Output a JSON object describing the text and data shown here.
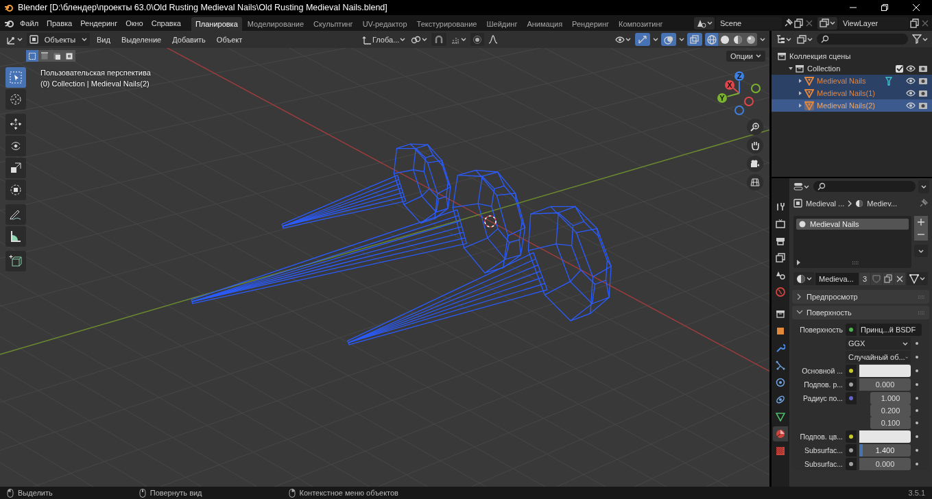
{
  "window": {
    "title": "Blender [D:\\блендер\\проекты 63.0\\Old Rusting Medieval Nails\\Old Rusting Medieval Nails.blend]"
  },
  "menu": [
    "Файл",
    "Правка",
    "Рендеринг",
    "Окно",
    "Справка"
  ],
  "workspaces": [
    {
      "label": "Планировка",
      "selected": true
    },
    {
      "label": "Моделирование",
      "selected": false
    },
    {
      "label": "Скульптинг",
      "selected": false
    },
    {
      "label": "UV-редактор",
      "selected": false
    },
    {
      "label": "Текстурирование",
      "selected": false
    },
    {
      "label": "Шейдинг",
      "selected": false
    },
    {
      "label": "Анимация",
      "selected": false
    },
    {
      "label": "Рендеринг",
      "selected": false
    },
    {
      "label": "Композитинг",
      "selected": false
    }
  ],
  "scene": {
    "name": "Scene"
  },
  "view_layer": {
    "name": "ViewLayer"
  },
  "viewport": {
    "mode": "Объекты",
    "menus": [
      "Вид",
      "Выделение",
      "Добавить",
      "Объект"
    ],
    "orientation": "Глоба...",
    "options": "Опции",
    "view_name": "Пользовательская перспектива",
    "context": "(0) Collection | Medieval Nails(2)",
    "axes": [
      "X",
      "Y",
      "Z"
    ],
    "gizmos_on": true,
    "overlays_on": true,
    "xray_on": true,
    "shading": [
      {
        "selected": true
      },
      {
        "selected": false
      },
      {
        "selected": false
      },
      {
        "selected": false
      }
    ],
    "select_modes": [
      {
        "selected": true
      },
      {
        "selected": false
      },
      {
        "selected": false
      },
      {
        "selected": false
      }
    ],
    "tools": [
      {
        "selected": true
      },
      {
        "selected": false
      },
      {
        "selected": false
      },
      {
        "selected": false
      },
      {
        "selected": false
      },
      {
        "selected": false
      },
      {
        "selected": false
      },
      {
        "selected": false
      },
      {
        "selected": false
      }
    ]
  },
  "outliner": {
    "tree": [
      {
        "label": "Коллекция сцены",
        "children": [
          {
            "label": "Collection",
            "expanded": true,
            "checked": true,
            "children": [
              {
                "label": "Medieval Nails",
                "selected": true,
                "active": false,
                "expanded": false,
                "modifier_icon": true
              },
              {
                "label": "Medieval Nails(1)",
                "selected": true,
                "active": false,
                "expanded": false,
                "modifier_icon": false
              },
              {
                "label": "Medieval Nails(2)",
                "selected": true,
                "active": true,
                "expanded": false,
                "modifier_icon": false
              }
            ]
          }
        ]
      }
    ]
  },
  "properties": {
    "tabs": [
      {
        "selected": false
      },
      {
        "selected": false
      },
      {
        "selected": false
      },
      {
        "selected": false
      },
      {
        "selected": false
      },
      {
        "selected": false
      },
      {
        "selected": false
      },
      {
        "selected": false
      },
      {
        "selected": false
      },
      {
        "selected": false
      },
      {
        "selected": false
      },
      {
        "selected": false
      },
      {
        "selected": false
      },
      {
        "selected": true
      },
      {
        "selected": false
      }
    ],
    "breadcrumb": [
      "Medieval ...",
      "Mediev..."
    ],
    "slots": [
      {
        "label": "Medieval Nails",
        "selected": true
      }
    ],
    "material": {
      "name": "Medieva...",
      "users": "3"
    },
    "panels": [
      {
        "label": "Предпросмотр",
        "expanded": false
      },
      {
        "label": "Поверхность",
        "expanded": true
      }
    ],
    "rows": [
      {
        "kind": "shader",
        "label": "Поверхность",
        "value": "Принц...й BSDF",
        "color": "#4db34d"
      },
      {
        "kind": "dropdown",
        "value": "GGX"
      },
      {
        "kind": "dropdown",
        "value": "Случайный об..."
      },
      {
        "kind": "color",
        "label": "Основной ...",
        "swatch": {
          "color": "#e6e6e6"
        },
        "color": "#c7c729"
      },
      {
        "kind": "value",
        "label": "Подпов. р...",
        "value": "0.000",
        "color": "#a1a1a1"
      },
      {
        "kind": "vector",
        "label": "Радиус по...",
        "values": [
          "1.000",
          "0.200",
          "0.100"
        ],
        "color": "#6363c7"
      },
      {
        "kind": "color",
        "label": "Подпов. цв...",
        "swatch": {
          "color": "#e6e6e6"
        },
        "color": "#c7c729"
      },
      {
        "kind": "slider",
        "label": "Subsurfac...",
        "value": "1.400",
        "level": 0.07,
        "color": "#a1a1a1"
      },
      {
        "kind": "value",
        "label": "Subsurfac...",
        "value": "0.000",
        "color": "#a1a1a1"
      }
    ]
  },
  "status_bar": {
    "hints": [
      "Выделить",
      "Повернуть вид",
      "Контекстное меню объектов"
    ],
    "version": "3.5.1"
  }
}
